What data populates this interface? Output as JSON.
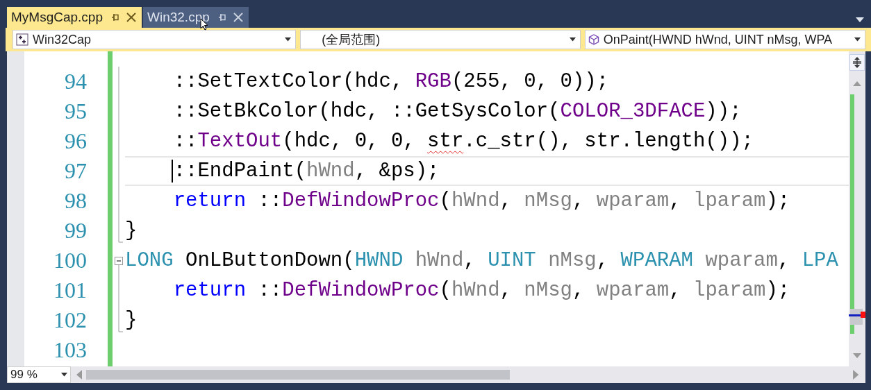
{
  "tabs": [
    {
      "label": "MyMsgCap.cpp",
      "selected": true
    },
    {
      "label": "Win32.cpp",
      "selected": false
    }
  ],
  "navigation_bar": {
    "project": "Win32Cap",
    "scope": "(全局范围)",
    "member": "OnPaint(HWND hWnd, UINT nMsg, WPA"
  },
  "code_lines": [
    {
      "number": "94",
      "current": false,
      "collapsible": false,
      "block_end": false,
      "tokens": [
        {
          "kind": "plain",
          "text": "    ::SetTextColor(hdc, "
        },
        {
          "kind": "macro",
          "text": "RGB"
        },
        {
          "kind": "plain",
          "text": "(255, 0, 0));"
        }
      ]
    },
    {
      "number": "95",
      "current": false,
      "collapsible": false,
      "block_end": false,
      "tokens": [
        {
          "kind": "plain",
          "text": "    ::SetBkColor(hdc, ::GetSysColor("
        },
        {
          "kind": "macro",
          "text": "COLOR_3DFACE"
        },
        {
          "kind": "plain",
          "text": "));"
        }
      ]
    },
    {
      "number": "96",
      "current": false,
      "collapsible": false,
      "block_end": false,
      "tokens": [
        {
          "kind": "plain",
          "text": "    ::"
        },
        {
          "kind": "macro",
          "text": "TextOut"
        },
        {
          "kind": "plain",
          "text": "(hdc, 0, 0, "
        },
        {
          "kind": "error",
          "text": "str"
        },
        {
          "kind": "plain",
          "text": ".c_str(), str.length());"
        }
      ]
    },
    {
      "number": "97",
      "current": true,
      "collapsible": false,
      "block_end": false,
      "tokens": [
        {
          "kind": "plain",
          "text": "    ::EndPaint("
        },
        {
          "kind": "param",
          "text": "hWnd"
        },
        {
          "kind": "plain",
          "text": ", &ps);"
        }
      ]
    },
    {
      "number": "98",
      "current": false,
      "collapsible": false,
      "block_end": false,
      "tokens": [
        {
          "kind": "keyword",
          "text": "    return"
        },
        {
          "kind": "plain",
          "text": " ::"
        },
        {
          "kind": "macro",
          "text": "DefWindowProc"
        },
        {
          "kind": "plain",
          "text": "("
        },
        {
          "kind": "param",
          "text": "hWnd"
        },
        {
          "kind": "plain",
          "text": ", "
        },
        {
          "kind": "param",
          "text": "nMsg"
        },
        {
          "kind": "plain",
          "text": ", "
        },
        {
          "kind": "param",
          "text": "wparam"
        },
        {
          "kind": "plain",
          "text": ", "
        },
        {
          "kind": "param",
          "text": "lparam"
        },
        {
          "kind": "plain",
          "text": ");"
        }
      ]
    },
    {
      "number": "99",
      "current": false,
      "collapsible": false,
      "block_end": true,
      "tokens": [
        {
          "kind": "plain",
          "text": "}"
        }
      ]
    },
    {
      "number": "100",
      "current": false,
      "collapsible": true,
      "block_end": false,
      "tokens": [
        {
          "kind": "type",
          "text": "LONG"
        },
        {
          "kind": "plain",
          "text": " OnLButtonDown("
        },
        {
          "kind": "type",
          "text": "HWND"
        },
        {
          "kind": "param",
          "text": " hWnd"
        },
        {
          "kind": "plain",
          "text": ", "
        },
        {
          "kind": "type",
          "text": "UINT"
        },
        {
          "kind": "param",
          "text": " nMsg"
        },
        {
          "kind": "plain",
          "text": ", "
        },
        {
          "kind": "type",
          "text": "WPARAM"
        },
        {
          "kind": "param",
          "text": " wparam"
        },
        {
          "kind": "plain",
          "text": ", "
        },
        {
          "kind": "type",
          "text": "LPA"
        }
      ]
    },
    {
      "number": "101",
      "current": false,
      "collapsible": false,
      "block_end": false,
      "tokens": [
        {
          "kind": "keyword",
          "text": "    return"
        },
        {
          "kind": "plain",
          "text": " ::"
        },
        {
          "kind": "macro",
          "text": "DefWindowProc"
        },
        {
          "kind": "plain",
          "text": "("
        },
        {
          "kind": "param",
          "text": "hWnd"
        },
        {
          "kind": "plain",
          "text": ", "
        },
        {
          "kind": "param",
          "text": "nMsg"
        },
        {
          "kind": "plain",
          "text": ", "
        },
        {
          "kind": "param",
          "text": "wparam"
        },
        {
          "kind": "plain",
          "text": ", "
        },
        {
          "kind": "param",
          "text": "lparam"
        },
        {
          "kind": "plain",
          "text": ");"
        }
      ]
    },
    {
      "number": "102",
      "current": false,
      "collapsible": false,
      "block_end": true,
      "tokens": [
        {
          "kind": "plain",
          "text": "}"
        }
      ]
    },
    {
      "number": "103",
      "current": false,
      "collapsible": false,
      "block_end": false
    }
  ],
  "zoom": "99 %"
}
